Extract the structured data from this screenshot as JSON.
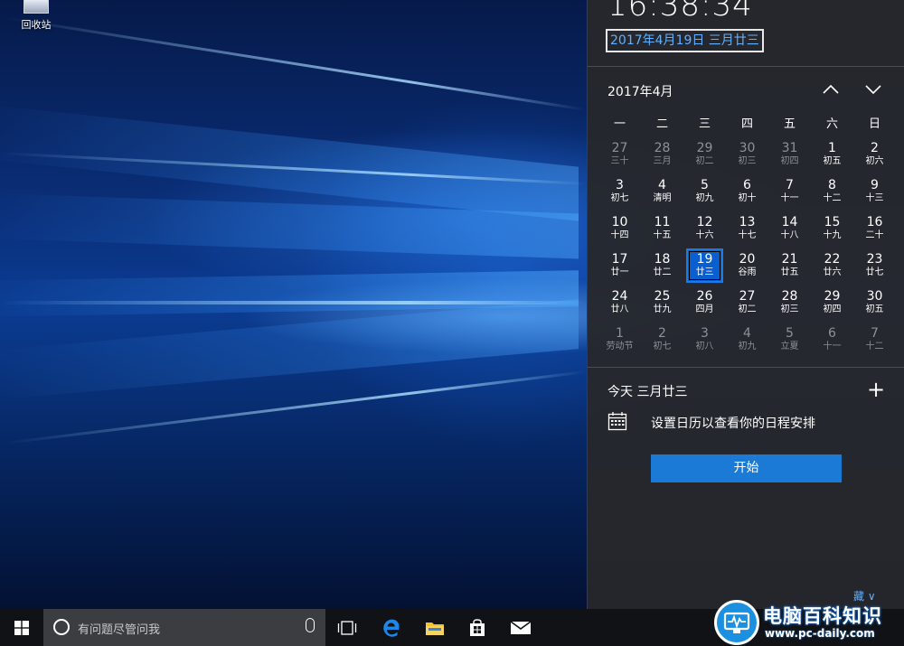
{
  "desktop": {
    "recycle_bin_label": "回收站"
  },
  "flyout": {
    "time": "16:38:34",
    "full_date": "2017年4月19日 三月廿三",
    "month_label": "2017年4月",
    "prev_icon": "chevron-up-icon",
    "next_icon": "chevron-down-icon",
    "weekdays": [
      "一",
      "二",
      "三",
      "四",
      "五",
      "六",
      "日"
    ],
    "weeks": [
      [
        {
          "n": "27",
          "l": "三十",
          "dim": true
        },
        {
          "n": "28",
          "l": "三月",
          "dim": true
        },
        {
          "n": "29",
          "l": "初二",
          "dim": true
        },
        {
          "n": "30",
          "l": "初三",
          "dim": true
        },
        {
          "n": "31",
          "l": "初四",
          "dim": true
        },
        {
          "n": "1",
          "l": "初五"
        },
        {
          "n": "2",
          "l": "初六"
        }
      ],
      [
        {
          "n": "3",
          "l": "初七"
        },
        {
          "n": "4",
          "l": "清明"
        },
        {
          "n": "5",
          "l": "初九"
        },
        {
          "n": "6",
          "l": "初十"
        },
        {
          "n": "7",
          "l": "十一"
        },
        {
          "n": "8",
          "l": "十二"
        },
        {
          "n": "9",
          "l": "十三"
        }
      ],
      [
        {
          "n": "10",
          "l": "十四"
        },
        {
          "n": "11",
          "l": "十五"
        },
        {
          "n": "12",
          "l": "十六"
        },
        {
          "n": "13",
          "l": "十七"
        },
        {
          "n": "14",
          "l": "十八"
        },
        {
          "n": "15",
          "l": "十九"
        },
        {
          "n": "16",
          "l": "二十"
        }
      ],
      [
        {
          "n": "17",
          "l": "廿一"
        },
        {
          "n": "18",
          "l": "廿二"
        },
        {
          "n": "19",
          "l": "廿三",
          "today": true
        },
        {
          "n": "20",
          "l": "谷雨"
        },
        {
          "n": "21",
          "l": "廿五"
        },
        {
          "n": "22",
          "l": "廿六"
        },
        {
          "n": "23",
          "l": "廿七"
        }
      ],
      [
        {
          "n": "24",
          "l": "廿八"
        },
        {
          "n": "25",
          "l": "廿九"
        },
        {
          "n": "26",
          "l": "四月"
        },
        {
          "n": "27",
          "l": "初二"
        },
        {
          "n": "28",
          "l": "初三"
        },
        {
          "n": "29",
          "l": "初四"
        },
        {
          "n": "30",
          "l": "初五"
        }
      ],
      [
        {
          "n": "1",
          "l": "劳动节",
          "dim": true
        },
        {
          "n": "2",
          "l": "初七",
          "dim": true
        },
        {
          "n": "3",
          "l": "初八",
          "dim": true
        },
        {
          "n": "4",
          "l": "初九",
          "dim": true
        },
        {
          "n": "5",
          "l": "立夏",
          "dim": true
        },
        {
          "n": "6",
          "l": "十一",
          "dim": true
        },
        {
          "n": "7",
          "l": "十二",
          "dim": true
        }
      ]
    ],
    "agenda_heading": "今天 三月廿三",
    "agenda_add": "+",
    "agenda_message": "设置日历以查看你的日程安排",
    "start_button": "开始",
    "hide_agenda": "隐藏日程 ∨",
    "hide_agenda_visible": "藏 ∨"
  },
  "taskbar": {
    "search_placeholder": "有问题尽管问我",
    "icons": [
      "windows-start-icon",
      "cortana-icon",
      "microphone-icon",
      "task-view-icon",
      "edge-icon",
      "file-explorer-icon",
      "store-icon",
      "mail-icon"
    ]
  },
  "watermark": {
    "title": "电脑百科知识",
    "url": "www.pc-daily.com"
  },
  "colors": {
    "accent": "#1a7ad6",
    "today_highlight": "#0a5fd0",
    "link": "#5fb0ff",
    "flyout_bg": "#26282c",
    "taskbar_bg": "#101216"
  }
}
